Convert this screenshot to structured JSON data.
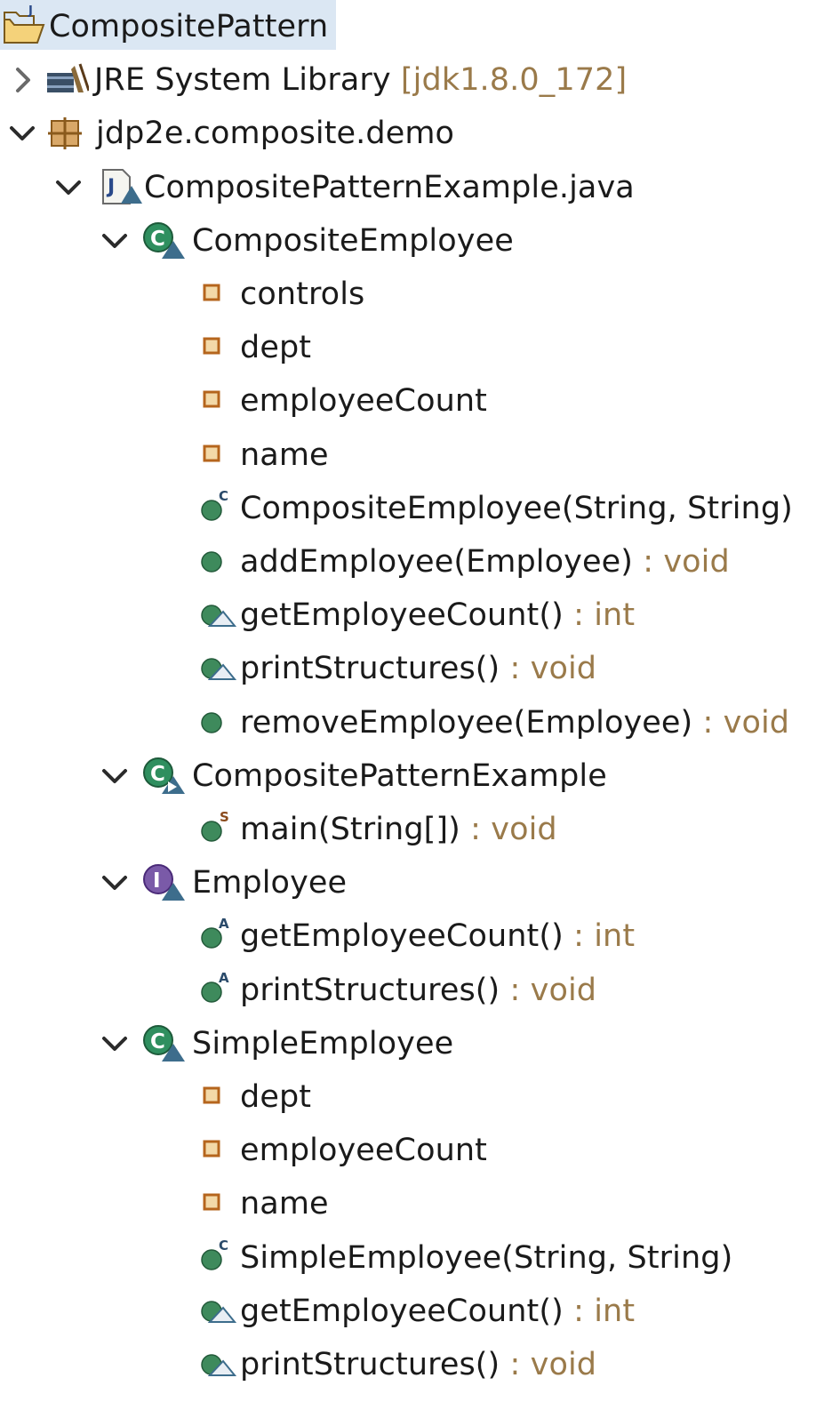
{
  "tree": [
    {
      "label": "CompositePattern",
      "icon": "project-folder-icon",
      "state": "none"
    },
    {
      "label": "JRE System Library",
      "decoration": " [jdk1.8.0_172]",
      "icon": "library-icon",
      "state": "collapsed"
    },
    {
      "label": "jdp2e.composite.demo",
      "icon": "package-icon",
      "state": "expanded"
    },
    {
      "label": "CompositePatternExample.java",
      "icon": "java-file-icon",
      "state": "expanded"
    },
    {
      "label": "CompositeEmployee",
      "icon": "class-icon",
      "state": "expanded"
    },
    {
      "label": "controls",
      "icon": "private-field-icon",
      "state": "none"
    },
    {
      "label": "dept",
      "icon": "private-field-icon",
      "state": "none"
    },
    {
      "label": "employeeCount",
      "icon": "private-field-icon",
      "state": "none"
    },
    {
      "label": "name",
      "icon": "private-field-icon",
      "state": "none"
    },
    {
      "label": "CompositeEmployee(String, String)",
      "icon": "constructor-icon",
      "state": "none"
    },
    {
      "label": "addEmployee(Employee)",
      "decoration": " : void",
      "icon": "public-method-icon",
      "state": "none"
    },
    {
      "label": "getEmployeeCount()",
      "decoration": " : int",
      "icon": "override-method-icon",
      "state": "none"
    },
    {
      "label": "printStructures()",
      "decoration": " : void",
      "icon": "override-method-icon",
      "state": "none"
    },
    {
      "label": "removeEmployee(Employee)",
      "decoration": " : void",
      "icon": "public-method-icon",
      "state": "none"
    },
    {
      "label": "CompositePatternExample",
      "icon": "main-class-icon",
      "state": "expanded"
    },
    {
      "label": "main(String[])",
      "decoration": " : void",
      "icon": "static-method-icon",
      "state": "none"
    },
    {
      "label": "Employee",
      "icon": "interface-icon",
      "state": "expanded"
    },
    {
      "label": "getEmployeeCount()",
      "decoration": " : int",
      "icon": "abstract-method-icon",
      "state": "none"
    },
    {
      "label": "printStructures()",
      "decoration": " : void",
      "icon": "abstract-method-icon",
      "state": "none"
    },
    {
      "label": "SimpleEmployee",
      "icon": "class-icon",
      "state": "expanded"
    },
    {
      "label": "dept",
      "icon": "private-field-icon",
      "state": "none"
    },
    {
      "label": "employeeCount",
      "icon": "private-field-icon",
      "state": "none"
    },
    {
      "label": "name",
      "icon": "private-field-icon",
      "state": "none"
    },
    {
      "label": "SimpleEmployee(String, String)",
      "icon": "constructor-icon",
      "state": "none"
    },
    {
      "label": "getEmployeeCount()",
      "decoration": " : int",
      "icon": "override-method-icon",
      "state": "none"
    },
    {
      "label": "printStructures()",
      "decoration": " : void",
      "icon": "override-method-icon",
      "state": "none"
    }
  ],
  "colors": {
    "selection": "#dbe7f3",
    "decoration_text": "#9a7a4a",
    "class_green": "#2f8f5f",
    "method_green": "#3e8a5c",
    "field_orange": "#b5651d",
    "chevron": "#2b2b2b"
  }
}
